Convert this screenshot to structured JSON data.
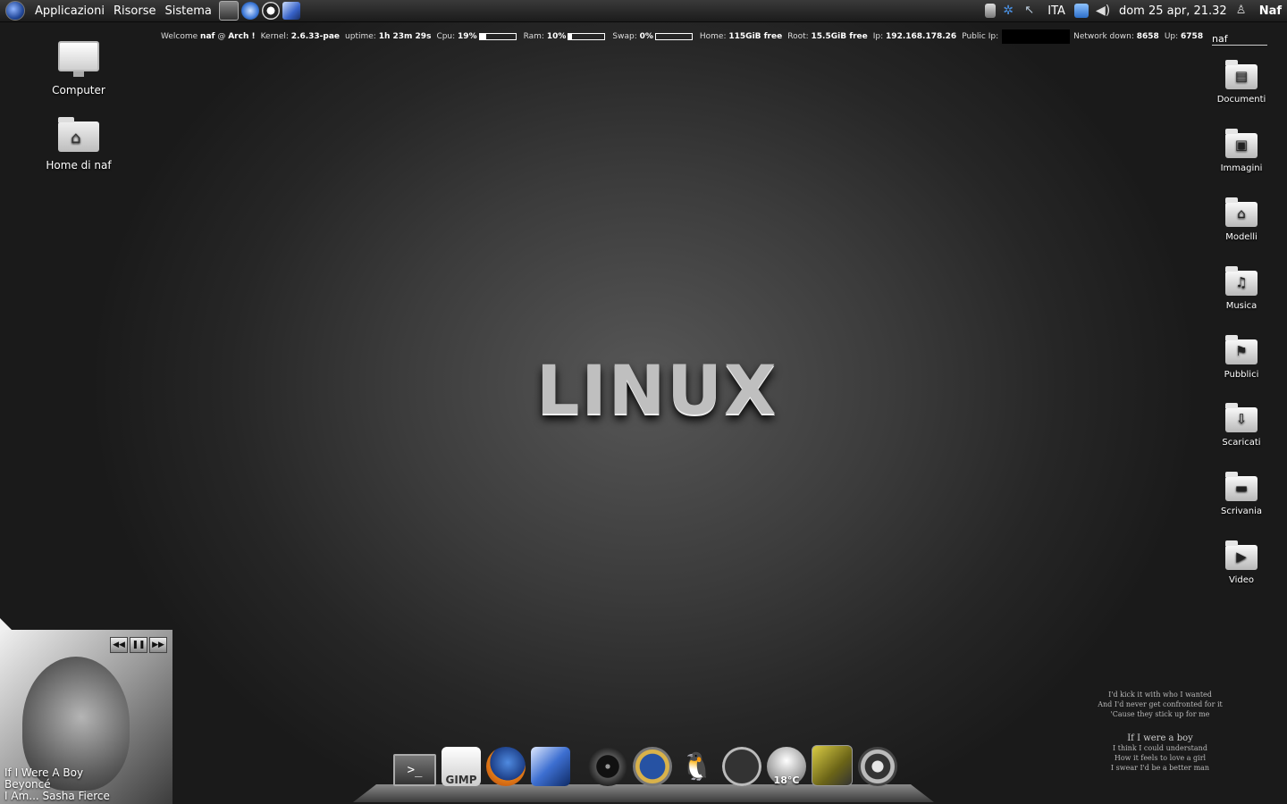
{
  "panel": {
    "menus": [
      "Applicazioni",
      "Risorse",
      "Sistema"
    ],
    "launchers": [
      "terminal-launcher-icon",
      "web-browser-launcher-icon",
      "update-launcher-icon",
      "thunderbird-launcher-icon"
    ],
    "tray": {
      "keyboard_layout": "ITA",
      "clock": "dom 25 apr, 21.32",
      "user": "Naf"
    }
  },
  "conky": {
    "welcome": "Welcome",
    "user": "naf",
    "at": "@",
    "host": "Arch !",
    "kernel_label": "Kernel:",
    "kernel": "2.6.33-pae",
    "uptime_label": "uptime:",
    "uptime": "1h 23m 29s",
    "cpu_label": "Cpu:",
    "cpu": "19%",
    "cpu_fraction": 0.19,
    "ram_label": "Ram:",
    "ram": "10%",
    "ram_fraction": 0.1,
    "swap_label": "Swap:",
    "swap": "0%",
    "swap_fraction": 0.0,
    "home_label": "Home:",
    "home": "115GiB free",
    "root_label": "Root:",
    "root": "15.5GiB free",
    "ip_label": "Ip:",
    "ip": "192.168.178.26",
    "public_ip_label": "Public Ip:",
    "net_down_label": "Network down:",
    "net_down": "8658",
    "up_label": "Up:",
    "up": "6758"
  },
  "desktop_left": [
    {
      "label": "Computer"
    },
    {
      "label": "Home di naf"
    }
  ],
  "desktop_right": {
    "header": "naf",
    "items": [
      {
        "label": "Documenti",
        "glyph": "▤"
      },
      {
        "label": "Immagini",
        "glyph": "▣"
      },
      {
        "label": "Modelli",
        "glyph": "⌂"
      },
      {
        "label": "Musica",
        "glyph": "♫"
      },
      {
        "label": "Pubblici",
        "glyph": "⚑"
      },
      {
        "label": "Scaricati",
        "glyph": "⇩"
      },
      {
        "label": "Scrivania",
        "glyph": "▬"
      },
      {
        "label": "Video",
        "glyph": "▶"
      }
    ]
  },
  "wallpaper_text": "LINUX",
  "player": {
    "title": "If I Were A Boy",
    "artist": "Beyoncé",
    "album": "I Am... Sasha Fierce",
    "controls": [
      "◀◀",
      "❚❚",
      "▶▶"
    ]
  },
  "lyrics": {
    "lines_top": [
      "I'd kick it with who I wanted",
      "And I'd never get confronted for it",
      "'Cause they stick up for me"
    ],
    "title": "If I were a boy",
    "lines_bottom": [
      "I think I could understand",
      "How it feels to love a girl",
      "I swear I'd be a better man"
    ]
  },
  "dock": {
    "items": [
      {
        "name": "terminal-icon",
        "label": ">_"
      },
      {
        "name": "gimp-icon",
        "label": "GIMP"
      },
      {
        "name": "firefox-icon",
        "label": ""
      },
      {
        "name": "thunderbird-icon",
        "label": ""
      },
      {
        "name": "cd-player-icon",
        "label": ""
      },
      {
        "name": "globe-icon",
        "label": ""
      },
      {
        "name": "tux-icon",
        "label": "🐧"
      },
      {
        "name": "clock-icon",
        "label": ""
      },
      {
        "name": "weather-icon",
        "label": "18°C"
      },
      {
        "name": "archive-icon",
        "label": ""
      },
      {
        "name": "trash-icon",
        "label": ""
      }
    ]
  },
  "colors": {
    "panel": "#1b1b1b",
    "background_center": "#575757",
    "background_edge": "#1a1a1a"
  }
}
